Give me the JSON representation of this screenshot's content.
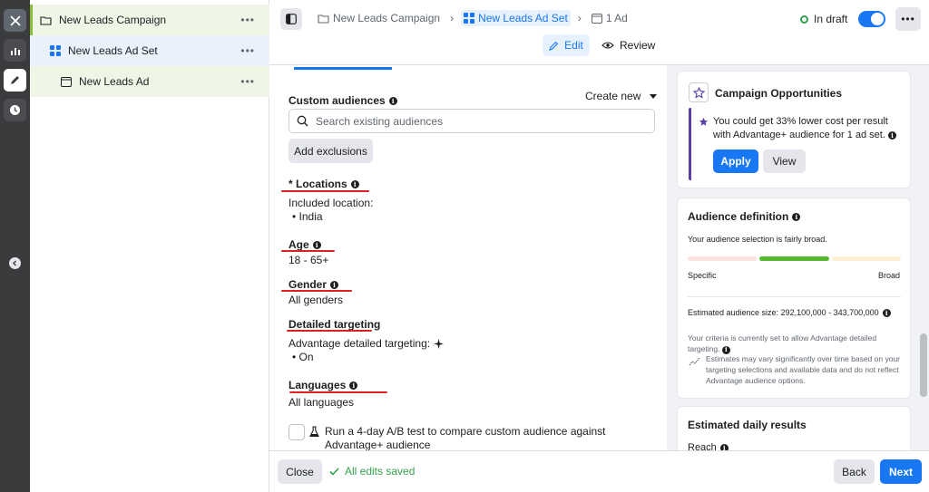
{
  "rail": {
    "items": [
      "close-icon",
      "reports-icon",
      "edit-icon",
      "history-icon"
    ]
  },
  "tree": {
    "campaign": "New Leads Campaign",
    "adset": "New Leads Ad Set",
    "ad": "New Leads Ad",
    "more": "•••"
  },
  "header": {
    "breadcrumbs": [
      "New Leads Campaign",
      "New Leads Ad Set",
      "1 Ad"
    ],
    "status": "In draft",
    "more": "•••",
    "edit_tab": "Edit",
    "review_tab": "Review"
  },
  "form": {
    "custom_audiences": {
      "title": "Custom audiences",
      "create_new": "Create new",
      "search_placeholder": "Search existing audiences",
      "add_exclusions": "Add exclusions"
    },
    "locations": {
      "title": "* Locations",
      "label": "Included location:",
      "value": "India"
    },
    "age": {
      "title": "Age",
      "value": "18 - 65+"
    },
    "gender": {
      "title": "Gender",
      "value": "All genders"
    },
    "detailed": {
      "title": "Detailed targeting",
      "label": "Advantage detailed targeting:",
      "value": "On"
    },
    "languages": {
      "title": "Languages",
      "value": "All languages"
    },
    "abtest": "Run a 4-day A/B test to compare custom audience against Advantage+ audience"
  },
  "opportunities": {
    "title": "Campaign Opportunities",
    "message": "You could get 33% lower cost per result with Advantage+ audience for 1 ad set.",
    "apply": "Apply",
    "view": "View"
  },
  "audience_definition": {
    "title": "Audience definition",
    "summary": "Your audience selection is fairly broad.",
    "specific": "Specific",
    "broad": "Broad",
    "size": "Estimated audience size: 292,100,000 - 343,700,000",
    "criteria": "Your criteria is currently set to allow Advantage detailed targeting.",
    "estimates": "Estimates may vary significantly over time based on your targeting selections and available data and do not reflect Advantage audience options.",
    "colors": {
      "specific": "#fbe3dc",
      "fairly_broad": "#56b82f",
      "broad": "#fdf0d2"
    }
  },
  "daily_results": {
    "title": "Estimated daily results",
    "reach": "Reach"
  },
  "footer": {
    "close": "Close",
    "saved": "All edits saved",
    "back": "Back",
    "next": "Next"
  }
}
